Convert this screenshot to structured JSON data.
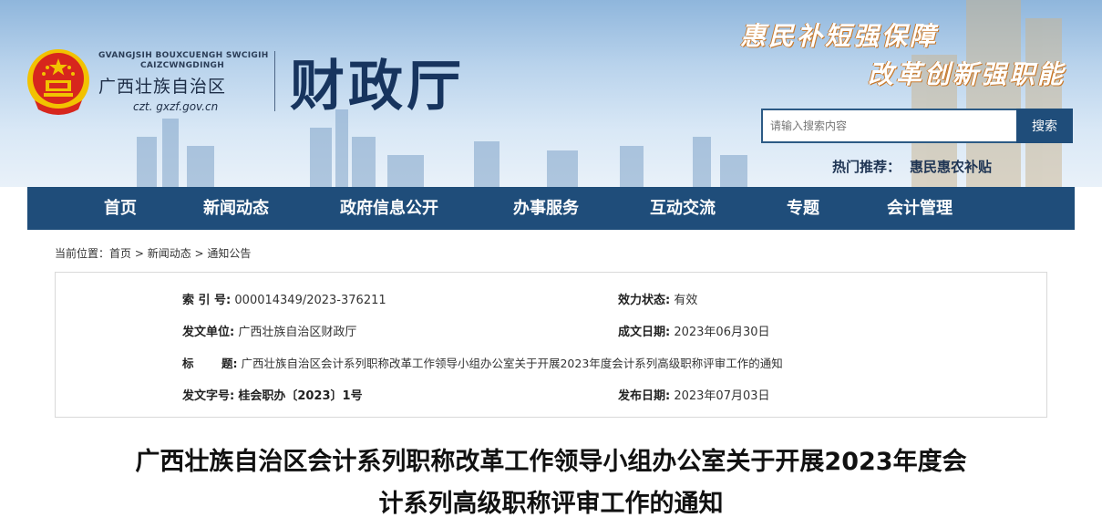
{
  "header": {
    "en_line1": "GVANGJSIH BOUXCUENGH SWCIGIH",
    "en_line2": "CAIZCWNGDINGH",
    "region": "广西壮族自治区",
    "url": "czt. gxzf.gov.cn",
    "dept": "财政厅",
    "slogan1": "惠民补短强保障",
    "slogan2": "改革创新强职能",
    "search_placeholder": "请输入搜索内容",
    "search_button": "搜索",
    "hot_label": "热门推荐：",
    "hot_link": "惠民惠农补贴"
  },
  "nav": {
    "items": [
      "首页",
      "新闻动态",
      "政府信息公开",
      "办事服务",
      "互动交流",
      "专题",
      "会计管理"
    ]
  },
  "breadcrumb": {
    "prefix": "当前位置：",
    "home": "首页",
    "sep": " > ",
    "section": "新闻动态",
    "current": "通知公告"
  },
  "meta": {
    "index_label": "索  引 号:",
    "index_value": "000014349/2023-376211",
    "status_label": "效力状态:",
    "status_value": "有效",
    "unit_label": "发文单位:",
    "unit_value": "广西壮族自治区财政厅",
    "created_label": "成文日期:",
    "created_value": "2023年06月30日",
    "title_label": "标       题:",
    "title_value": "广西壮族自治区会计系列职称改革工作领导小组办公室关于开展2023年度会计系列高级职称评审工作的通知",
    "doc_label": "发文字号:",
    "doc_value": "桂会职办〔2023〕1号",
    "pub_label": "发布日期:",
    "pub_value": "2023年07月03日"
  },
  "article": {
    "title_line1": "广西壮族自治区会计系列职称改革工作领导小组办公室关于开展2023年度会",
    "title_line2": "计系列高级职称评审工作的通知"
  },
  "colors": {
    "nav_bg": "#1f4d7a",
    "dept_text": "#17345e",
    "emblem_red": "#d7261d",
    "emblem_gold": "#f2c200"
  }
}
